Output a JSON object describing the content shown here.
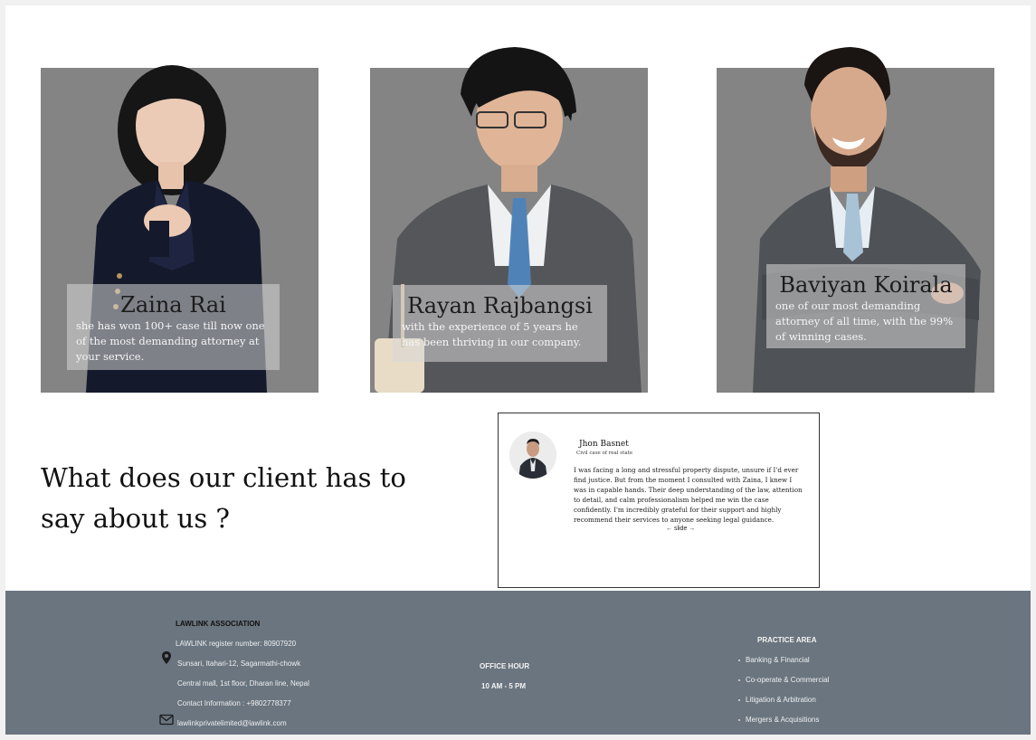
{
  "attorneys": [
    {
      "name": "Zaina Rai",
      "description": "she has won 100+ case till now one of the most demanding attorney at your service."
    },
    {
      "name": "Rayan Rajbangsi",
      "description": "with the experience of 5 years he has been thriving in our company."
    },
    {
      "name": "Baviyan Koirala",
      "description": "one of our most demanding attorney of all time, with the 99% of winning cases."
    }
  ],
  "testimonials": {
    "heading": "What does our client has to say about us ?",
    "client_name": "Jhon Basnet",
    "client_role": "Civil case of real state",
    "quote": "I was facing a long and stressful property dispute, unsure if I'd ever find justice. But from the moment I consulted with Zaina, I knew I was in capable hands. Their deep understanding of the law, attention to detail, and calm professionalism helped me win the case confidently. I'm incredibly grateful for their support and highly recommend their services to anyone seeking legal guidance.",
    "slide_control": "← slide →"
  },
  "footer": {
    "association": "LAWLINK ASSOCIATION",
    "register": "LAWLINK register number: 80907920",
    "address1": "Sunsari, Itahari-12, Sagarmathi-chowk",
    "address2": "Central mall, 1st floor, Dharan line, Nepal",
    "contact": "Contact Information :  +9802778377",
    "email": "lawlinkprivatelimited@lawlink.com",
    "office_hour_label": "OFFICE HOUR",
    "office_hours": "10 AM - 5 PM",
    "practice_area_label": "PRACTICE AREA",
    "practice_areas": [
      "Banking & Financial",
      "Co-operate & Commercial",
      "Litigation & Arbitration",
      "Mergers & Acquisitions"
    ]
  },
  "colors": {
    "card_bg": "#848484",
    "footer_bg": "#6b757f"
  }
}
